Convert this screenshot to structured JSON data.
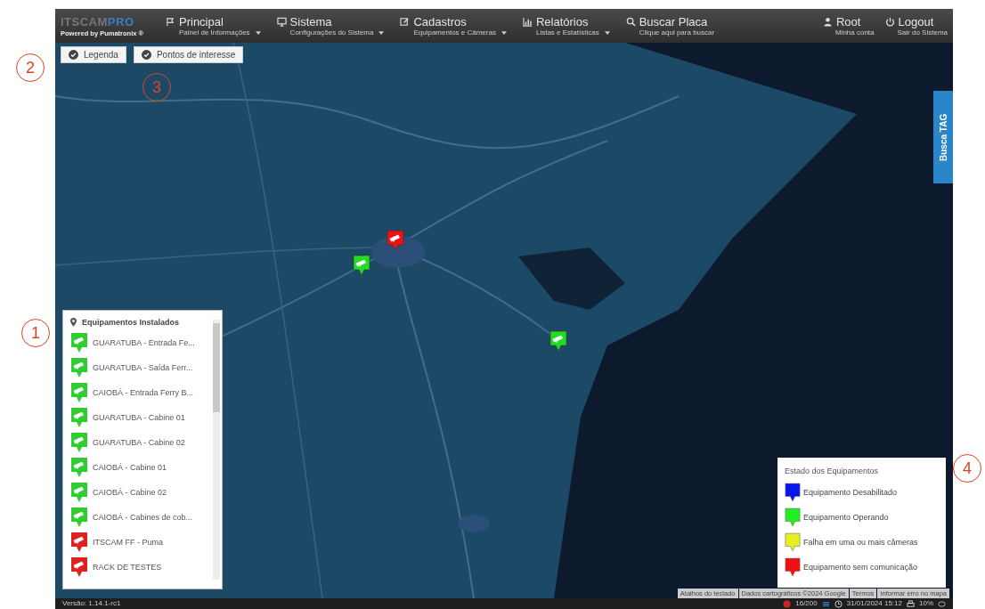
{
  "logo": {
    "name": "ITSCAM",
    "suffix": "PRO",
    "powered_by": "Powered by Pumatronix ®"
  },
  "nav": [
    {
      "kind": "flag",
      "title": "Principal",
      "subtitle": "Painel de Informações",
      "dropdown": true
    },
    {
      "kind": "monitor",
      "title": "Sistema",
      "subtitle": "Configurações do Sistema",
      "dropdown": true
    },
    {
      "kind": "edit",
      "title": "Cadastros",
      "subtitle": "Equipamentos e Câmeras",
      "dropdown": true
    },
    {
      "kind": "chart",
      "title": "Relatórios",
      "subtitle": "Listas e Estatísticas",
      "dropdown": true
    },
    {
      "kind": "search",
      "title": "Buscar Placa",
      "subtitle": "Clique aqui para buscar",
      "dropdown": false
    }
  ],
  "user_nav": [
    {
      "kind": "user",
      "title": "Root",
      "subtitle": "Minha conta"
    },
    {
      "kind": "power",
      "title": "Logout",
      "subtitle": "Sair do Sistema"
    }
  ],
  "map_buttons": [
    {
      "label": "Legenda",
      "checked": true
    },
    {
      "label": "Pontos de interesse",
      "checked": true
    }
  ],
  "side_tab": "Busca TAG",
  "map_markers": [
    {
      "color": "#ee1111"
    },
    {
      "color": "#22dd22"
    },
    {
      "color": "#22dd22"
    }
  ],
  "equipment_panel": {
    "title": "Equipamentos Instalados",
    "items": [
      {
        "name": "GUARATUBA - Entrada Fe...",
        "color": "#33cc33"
      },
      {
        "name": "GUARATUBA - Saída Ferr...",
        "color": "#33cc33"
      },
      {
        "name": "CAIOBÁ - Entrada Ferry B...",
        "color": "#33cc33"
      },
      {
        "name": "GUARATUBA - Cabine 01",
        "color": "#33cc33"
      },
      {
        "name": "GUARATUBA - Cabine 02",
        "color": "#33cc33"
      },
      {
        "name": "CAIOBÁ - Cabine 01",
        "color": "#33cc33"
      },
      {
        "name": "CAIOBÁ - Cabine 02",
        "color": "#33cc33"
      },
      {
        "name": "CAIOBÁ - Cabines de cob...",
        "color": "#33cc33"
      },
      {
        "name": "ITSCAM FF - Puma",
        "color": "#dd2222"
      },
      {
        "name": "RACK DE TESTES",
        "color": "#dd2222"
      }
    ]
  },
  "legend": {
    "title": "Estado dos Equipamentos",
    "items": [
      {
        "label": "Equipamento Desabilitado",
        "color": "#0a14f0"
      },
      {
        "label": "Equipamento Operando",
        "color": "#22ee22"
      },
      {
        "label": "Falha em uma ou mais câmeras",
        "color": "#e8ee22"
      },
      {
        "label": "Equipamento sem comunicação",
        "color": "#ee1111"
      }
    ]
  },
  "map_attribution": [
    "Atalhos do teclado",
    "Dados cartográficos ©2024 Google",
    "Termos",
    "Informar erro no mapa"
  ],
  "status_bar": {
    "version": "Versão: 1.14.1-rc1",
    "count": "16/200",
    "datetime": "31/01/2024 15:12",
    "printer": "10%"
  },
  "annotations": [
    {
      "number": "1"
    },
    {
      "number": "2"
    },
    {
      "number": "3"
    },
    {
      "number": "4"
    }
  ]
}
